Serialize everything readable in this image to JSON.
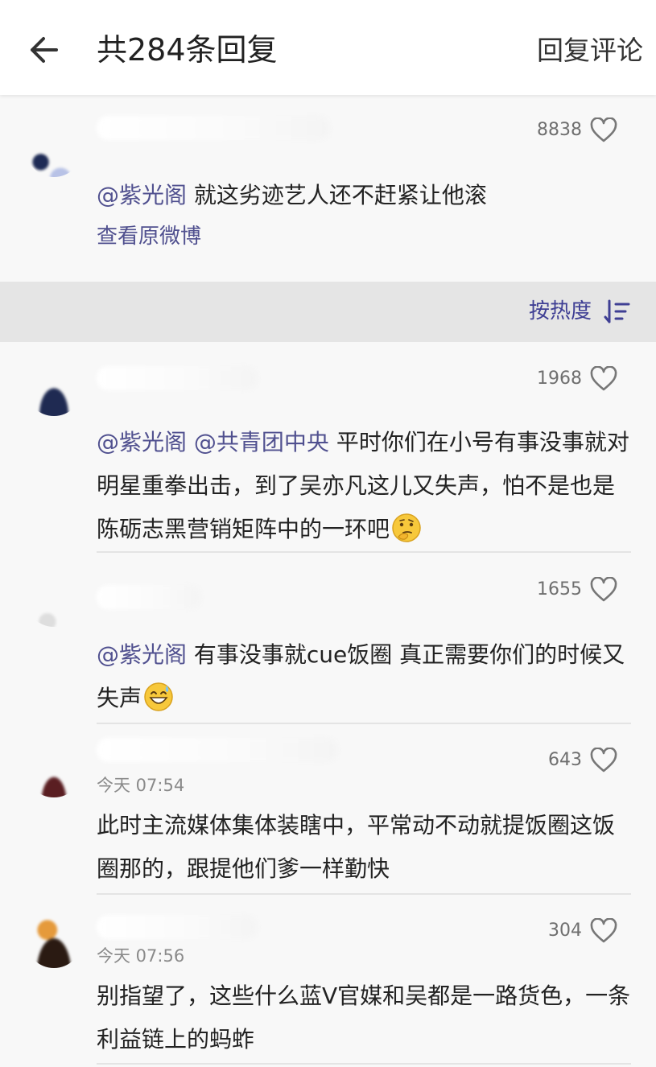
{
  "header": {
    "title": "共284条回复",
    "reply_button": "回复评论"
  },
  "root_comment": {
    "likes": "8838",
    "mention": "@紫光阁",
    "text": " 就这劣迹艺人还不赶紧让他滚",
    "view_original": "查看原微博"
  },
  "sort": {
    "label": "按热度"
  },
  "replies": [
    {
      "likes": "1968",
      "mention1": "@紫光阁",
      "mention2": " @共青团中央",
      "text": " 平时你们在小号有事没事就对明星重拳出击，到了吴亦凡这儿又失声，怕不是也是陈砺志黑营销矩阵中的一环吧",
      "emoji": "thinking-face"
    },
    {
      "likes": "1655",
      "mention": "@紫光阁",
      "text": " 有事没事就cue饭圈 真正需要你们的时候又失声",
      "emoji": "grinning-sweat-face"
    },
    {
      "likes": "643",
      "time": "今天 07:54",
      "text": "此时主流媒体集体装瞎中，平常动不动就提饭圈这饭圈那的，跟提他们爹一样勤快"
    },
    {
      "likes": "304",
      "time": "今天 07:56",
      "text": "别指望了，这些什么蓝V官媒和吴都是一路货色，一条利益链上的蚂蚱"
    }
  ],
  "colors": {
    "mention": "#50508f",
    "sort_text": "#3f3f94",
    "filter_bg": "#e5e5e5"
  }
}
